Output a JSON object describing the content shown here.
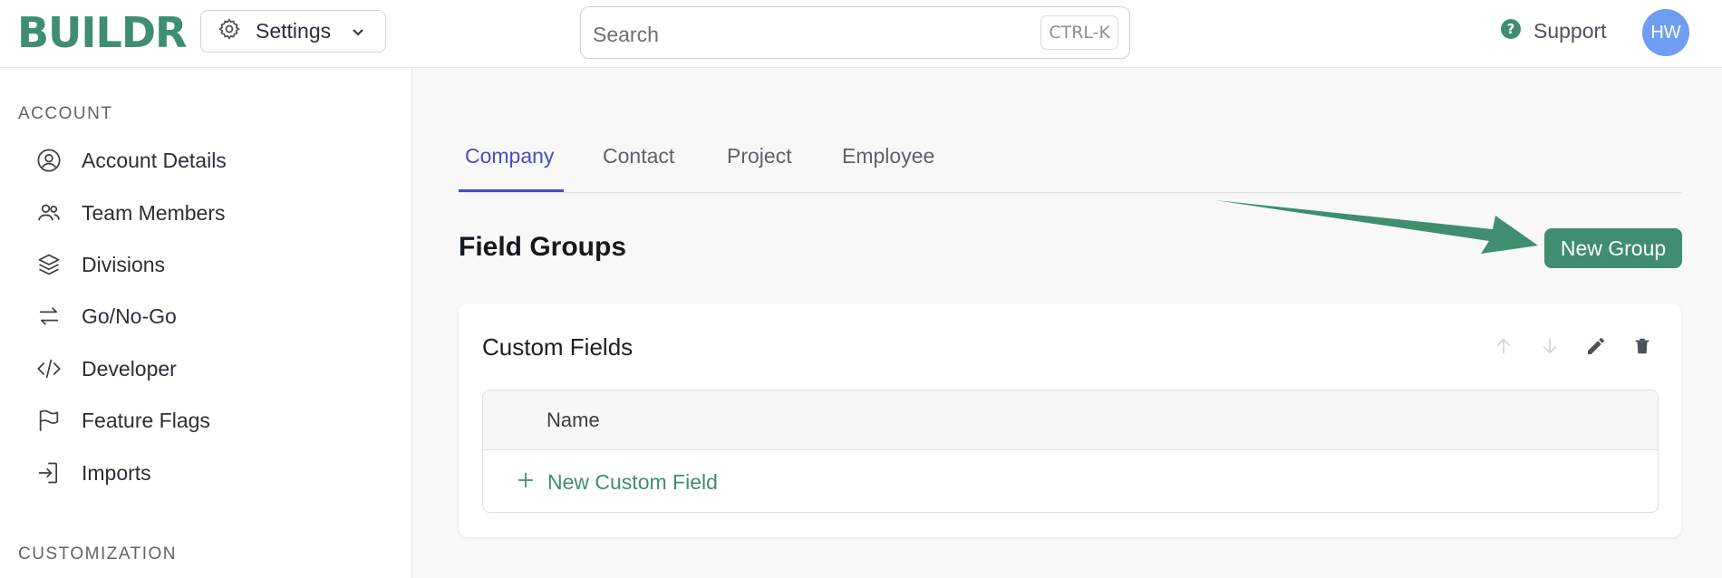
{
  "header": {
    "logo": "BUILDR",
    "settings_label": "Settings",
    "search_placeholder": "Search",
    "search_shortcut": "CTRL-K",
    "support_label": "Support",
    "avatar_initials": "HW"
  },
  "sidebar": {
    "sections": [
      {
        "label": "ACCOUNT"
      },
      {
        "label": "CUSTOMIZATION"
      }
    ],
    "items": [
      {
        "label": "Account Details",
        "icon": "user-circle-icon"
      },
      {
        "label": "Team Members",
        "icon": "users-icon"
      },
      {
        "label": "Divisions",
        "icon": "layers-icon"
      },
      {
        "label": "Go/No-Go",
        "icon": "arrows-swap-icon"
      },
      {
        "label": "Developer",
        "icon": "code-icon"
      },
      {
        "label": "Feature Flags",
        "icon": "flag-icon"
      },
      {
        "label": "Imports",
        "icon": "import-icon"
      }
    ]
  },
  "main": {
    "tabs": [
      {
        "label": "Company",
        "active": true
      },
      {
        "label": "Contact",
        "active": false
      },
      {
        "label": "Project",
        "active": false
      },
      {
        "label": "Employee",
        "active": false
      }
    ],
    "title": "Field Groups",
    "new_group_label": "New Group",
    "group": {
      "title": "Custom Fields",
      "column_header": "Name",
      "add_field_label": "New Custom Field"
    }
  },
  "colors": {
    "brand_green": "#3e8e6f",
    "tab_active": "#4a4bc9",
    "avatar_bg": "#6f9ef0"
  }
}
